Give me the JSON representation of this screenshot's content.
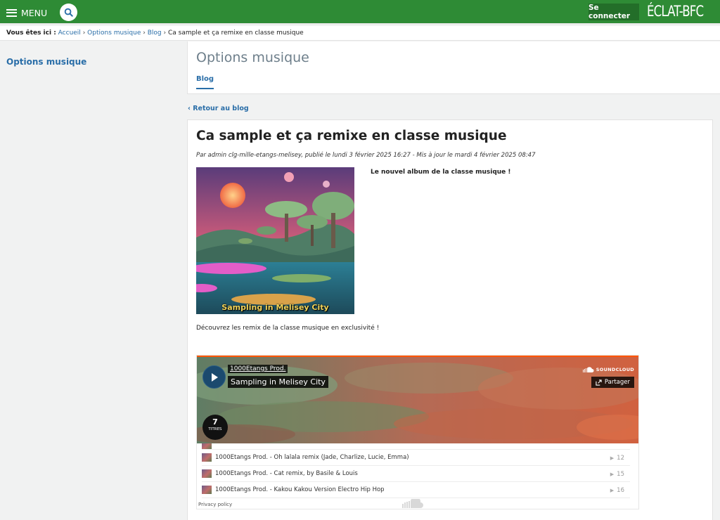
{
  "header": {
    "menu_label": "MENU",
    "login_label": "Se connecter",
    "logo_text": "ÉCLAT-BFC",
    "brand_color": "#2e8b35"
  },
  "breadcrumb": {
    "label": "Vous êtes ici :",
    "items": [
      "Accueil",
      "Options musique",
      "Blog"
    ],
    "current": "Ca sample et ça remixe en classe musique"
  },
  "sidebar": {
    "title": "Options musique"
  },
  "page": {
    "title": "Options musique",
    "tabs": [
      {
        "label": "Blog",
        "active": true
      }
    ],
    "back_link": "‹ Retour au blog"
  },
  "article": {
    "title": "Ca sample et ça remixe en classe musique",
    "meta": "Par admin clg-mille-etangs-melisey, publié le lundi 3 février 2025 16:27 - Mis à jour le mardi 4 février 2025 08:47",
    "cover_caption": "Sampling in Melisey City",
    "lead": "Le nouvel album de la classe musique !",
    "intro": "Découvrez les remix de la classe musique en exclusivité !"
  },
  "soundcloud": {
    "artist": "1000Etangs Prod.",
    "set_title": "Sampling in Melisey City",
    "brand": "SOUNDCLOUD",
    "share_label": "Partager",
    "track_count": "7",
    "track_count_label": "TITRES",
    "tracks": [
      {
        "title": "1000Etangs Prod. - Oh lalala remix (Jade, Charlize, Lucie, Emma)",
        "plays": "12"
      },
      {
        "title": "1000Etangs Prod. - Cat remix, by Basile & Louis",
        "plays": "15"
      },
      {
        "title": "1000Etangs Prod. - Kakou Kakou Version Electro Hip Hop",
        "plays": "16"
      }
    ],
    "privacy_label": "Privacy policy"
  }
}
